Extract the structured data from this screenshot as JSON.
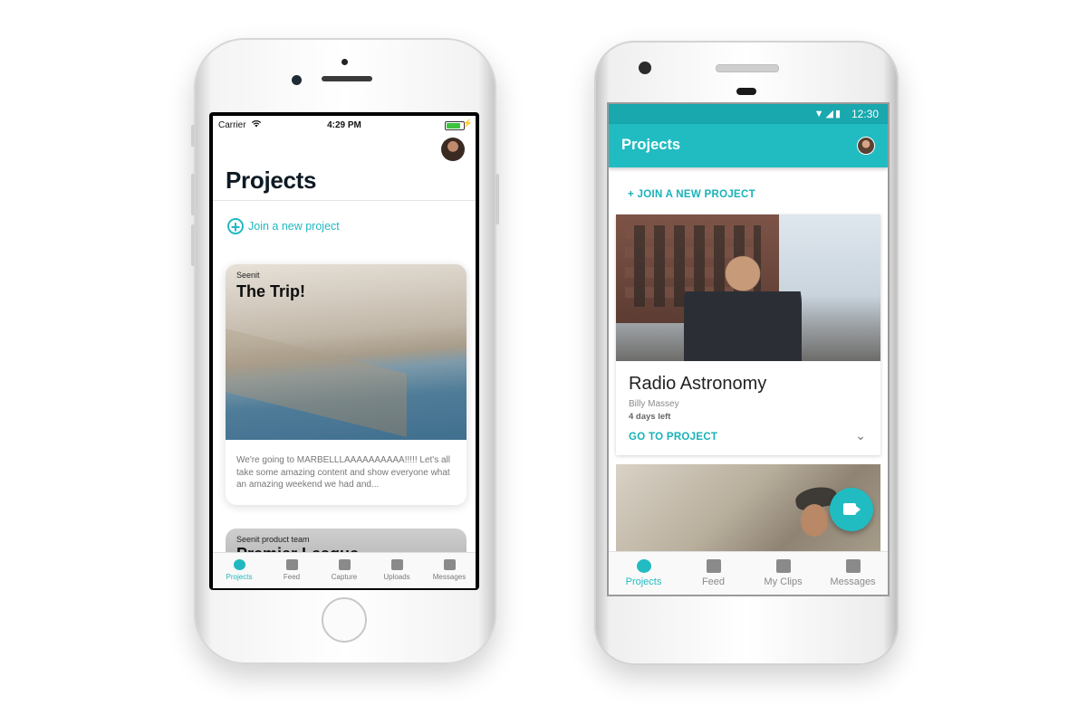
{
  "ios": {
    "status": {
      "carrier": "Carrier",
      "time": "4:29 PM",
      "battery_level": 0.85
    },
    "page_title": "Projects",
    "join_label": "Join a new project",
    "cards": [
      {
        "company": "Seenit",
        "title": "The Trip!",
        "description": "We're going to MARBELLLAAAAAAAAAA!!!!! Let's all take some amazing content and show everyone what an amazing weekend we had and..."
      },
      {
        "company": "Seenit product team",
        "title": "Premier League"
      }
    ],
    "tabs": [
      "Projects",
      "Feed",
      "Capture",
      "Uploads",
      "Messages"
    ]
  },
  "android": {
    "status": {
      "time": "12:30",
      "icons": "▼◢▮"
    },
    "app_title": "Projects",
    "join_label": "+ JOIN A NEW PROJECT",
    "card": {
      "title": "Radio Astronomy",
      "owner": "Billy Massey",
      "time_left": "4 days left",
      "action": "GO TO PROJECT",
      "expand_icon": "⌄"
    },
    "tabs": [
      "Projects",
      "Feed",
      "My Clips",
      "Messages"
    ]
  },
  "colors": {
    "accent": "#21bcc2",
    "status_bar": "#18a8ad"
  }
}
